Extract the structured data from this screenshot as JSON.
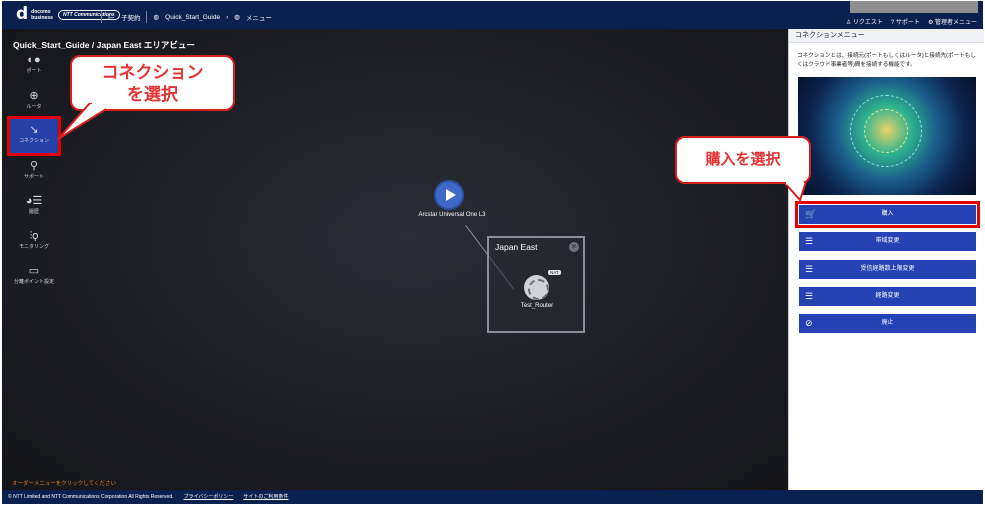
{
  "header": {
    "brand_mark": "d",
    "brand_line1": "docomo",
    "brand_line2": "business",
    "ntt": "NTT Communications",
    "nav": [
      {
        "label": "子契約",
        "icon": "subcontract-icon"
      },
      {
        "label": "Quick_Start_Guide",
        "icon": "circle-icon"
      },
      {
        "label": "メニュー",
        "icon": "circle-icon"
      }
    ],
    "right_links": [
      "リクエスト",
      "サポート",
      "管理者メニュー"
    ]
  },
  "breadcrumb": "Quick_Start_Guide / Japan East エリアビュー",
  "sidebar": [
    {
      "label": "ポート",
      "icon": "port-icon"
    },
    {
      "label": "ルータ",
      "icon": "router-icon"
    },
    {
      "label": "コネクション",
      "icon": "connection-icon",
      "active": true
    },
    {
      "label": "サポート",
      "icon": "support-icon"
    },
    {
      "label": "履歴",
      "icon": "history-icon"
    },
    {
      "label": "モニタリング",
      "icon": "monitoring-icon"
    },
    {
      "label": "分離ポイント設定",
      "icon": "monitor-icon"
    }
  ],
  "callout_connection": {
    "line1": "コネクション",
    "line2": "を選択"
  },
  "callout_purchase": "購入を選択",
  "diagram": {
    "l3_label": "Arcstar Universal One L3",
    "area_title": "Japan East",
    "nat_badge": "NAT",
    "router_label": "Test_Router"
  },
  "canvas_hint": "オーダーメニューをクリックしてください",
  "panel": {
    "title": "コネクションメニュー",
    "description": "コネクションとは、接続元(ポートもしくはルータ)と接続先(ポートもしくはクラウド事業者等)間を接続する機能です。",
    "buttons": [
      {
        "label": "購入",
        "icon": "cart-icon"
      },
      {
        "label": "帯域変更",
        "icon": "sliders-icon"
      },
      {
        "label": "受信経路数上限変更",
        "icon": "sliders-icon"
      },
      {
        "label": "経路変更",
        "icon": "sliders-icon"
      },
      {
        "label": "廃止",
        "icon": "block-icon"
      }
    ]
  },
  "footer": {
    "copyright": "© NTT Limited and NTT Communications Corporation All Rights Reserved.",
    "privacy": "プライバシーポリシー",
    "terms": "サイトのご利用条件"
  },
  "colors": {
    "accent": "#2442b3",
    "header": "#0a2150",
    "highlight": "#e50000",
    "hint": "#e07b2a"
  }
}
